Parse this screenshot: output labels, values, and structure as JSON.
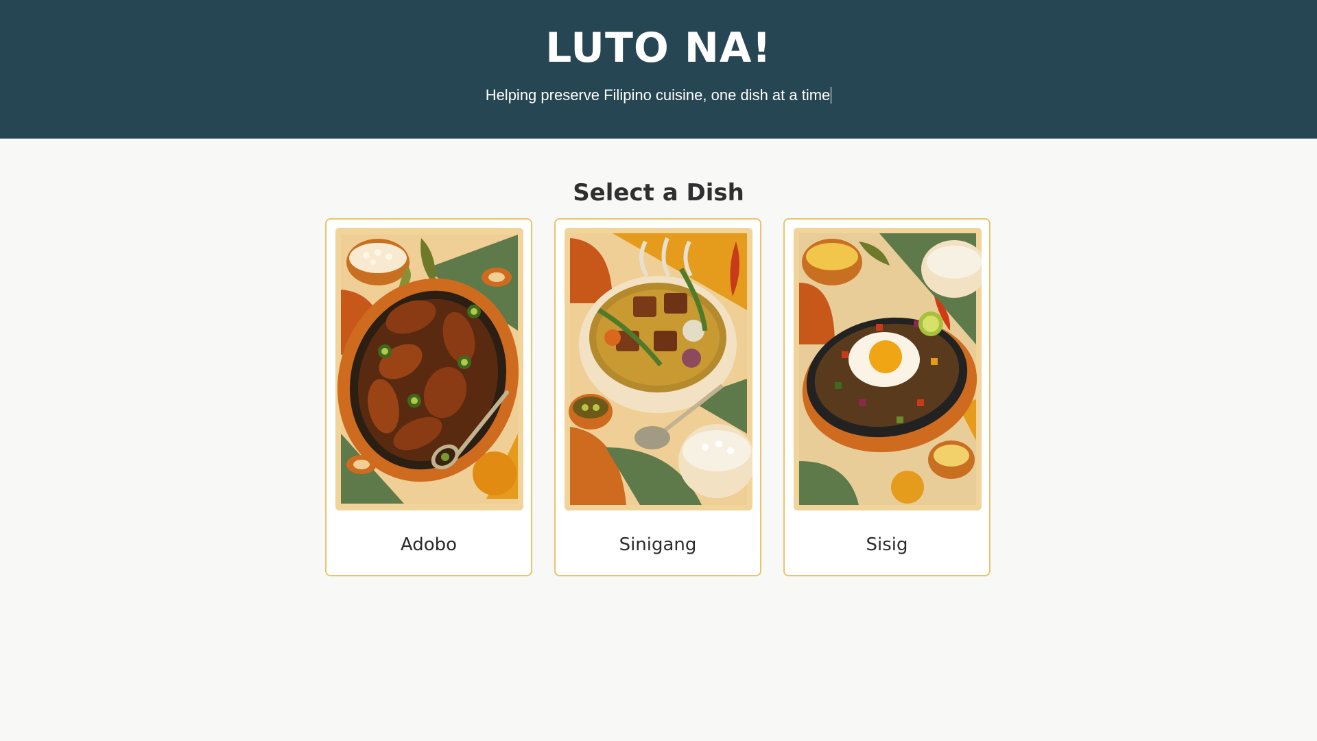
{
  "header": {
    "title": "LUTO NA!",
    "tagline": "Helping preserve Filipino cuisine, one dish at a time"
  },
  "main": {
    "section_title": "Select a Dish",
    "dishes": [
      {
        "label": "Adobo",
        "image_icon": "chicken-adobo-illustration"
      },
      {
        "label": "Sinigang",
        "image_icon": "sinigang-soup-illustration"
      },
      {
        "label": "Sisig",
        "image_icon": "sizzling-sisig-illustration"
      }
    ]
  },
  "colors": {
    "header_bg": "#264653",
    "page_bg": "#f8f8f7",
    "card_border": "#e9c46a",
    "text_dark": "#2b2b2b"
  }
}
